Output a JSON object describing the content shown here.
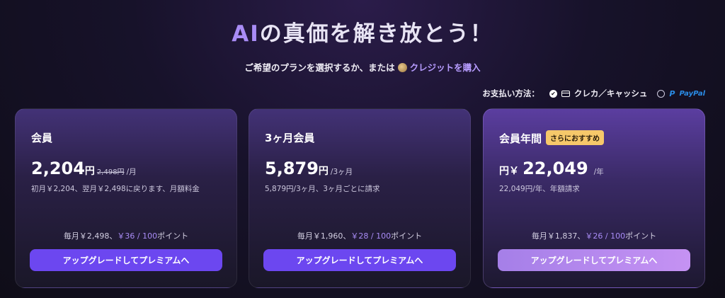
{
  "header": {
    "title_prefix": "AI",
    "title_rest": "の真価を解き放とう！",
    "subtitle_text": "ご希望のプランを選択するか、または",
    "credit_link": "クレジットを購入",
    "coin_icon": "coin-icon"
  },
  "payment": {
    "label": "お支払い方法：",
    "option_card": "クレカ／キャッシュ",
    "option_paypal_logo": "P",
    "option_paypal": "PayPal",
    "selected": "card"
  },
  "plans": [
    {
      "name": "会員",
      "price": "2,204",
      "unit": "円",
      "old_price": "2,498円",
      "per": "/月",
      "description": "初月￥2,204、翌月￥2,498に戻ります、月額料金",
      "points_prefix": "毎月￥2,498、",
      "points_highlight": "￥36 / 100",
      "points_suffix": "ポイント",
      "button": "アップグレードしてプレミアムへ"
    },
    {
      "name": "3ヶ月会員",
      "price": "5,879",
      "unit": "円",
      "per": "/3ヶ月",
      "description": "5,879円/3ヶ月、3ヶ月ごとに請求",
      "points_prefix": "毎月￥1,960、",
      "points_highlight": "￥28 / 100",
      "points_suffix": "ポイント",
      "button": "アップグレードしてプレミアムへ"
    },
    {
      "name": "会員年間",
      "badge": "さらにおすすめ",
      "currency": "円￥",
      "price": "22,049",
      "per": "/年",
      "description": "22,049円/年、年額請求",
      "points_prefix": "毎月￥1,837、",
      "points_highlight": "￥26 / 100",
      "points_suffix": "ポイント",
      "button": "アップグレードしてプレミアムへ"
    }
  ],
  "colors": {
    "accent": "#a98cf6",
    "button": "#6c47f0",
    "badge": "#f6c86a"
  }
}
